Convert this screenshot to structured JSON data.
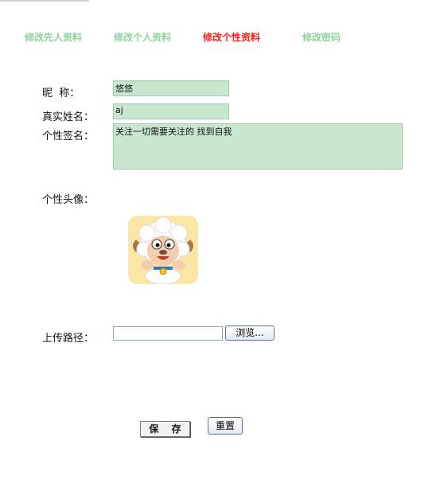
{
  "tabs": [
    {
      "label": "修改先人资料"
    },
    {
      "label": "修改个人资料"
    },
    {
      "label": "修改个性资料"
    },
    {
      "label": "修改密码"
    }
  ],
  "form": {
    "nickname_label": "昵  称：",
    "nickname_value": "悠悠",
    "realname_label": "真实姓名：",
    "realname_value": "aj",
    "signature_label": "个性签名：",
    "signature_value": "关注一切需要关注的 找到自我",
    "avatar_label": "个性头像：",
    "upload_label": "上传路径：",
    "browse_label": "浏览..."
  },
  "actions": {
    "save_label": "保 存",
    "reset_label": "重置"
  },
  "colors": {
    "tab_inactive": "#8fd39a",
    "tab_active": "#ff1a1a",
    "field_bg": "#c9e6cf"
  }
}
